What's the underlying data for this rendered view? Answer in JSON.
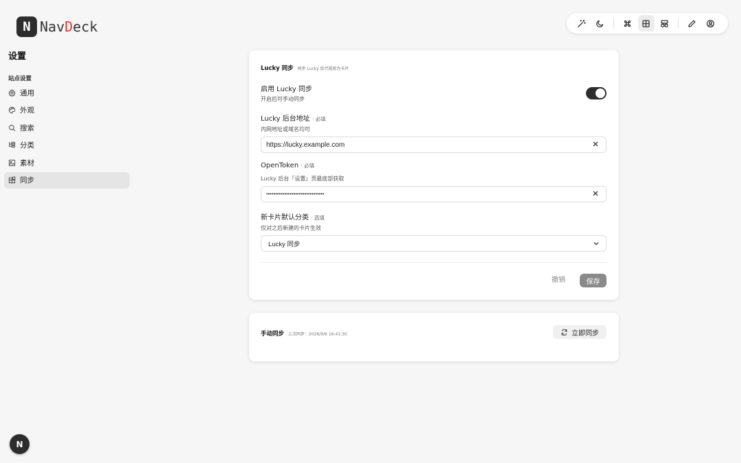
{
  "app": {
    "logo_letter": "N",
    "name_prefix": "Nav",
    "name_accent": "D",
    "name_suffix": "eck"
  },
  "toolbar": {
    "icons": [
      "magic-wand-icon",
      "moon-icon",
      "command-icon",
      "grid-icon",
      "layout-icon",
      "pencil-icon",
      "user-circle-icon"
    ],
    "active": "grid-icon"
  },
  "sidebar": {
    "title": "设置",
    "section": "站点设置",
    "items": [
      {
        "label": "通用",
        "icon": "gear-icon"
      },
      {
        "label": "外观",
        "icon": "palette-icon"
      },
      {
        "label": "搜索",
        "icon": "search-icon"
      },
      {
        "label": "分类",
        "icon": "tree-icon"
      },
      {
        "label": "素材",
        "icon": "image-icon"
      },
      {
        "label": "同步",
        "icon": "blocks-icon",
        "active": true
      }
    ]
  },
  "lucky_card": {
    "title": "Lucky 同步",
    "subtitle": "同步 Lucky 反代规则为卡片",
    "enable": {
      "label": "启用 Lucky 同步",
      "desc": "开启后可手动同步",
      "on": true
    },
    "address": {
      "label": "Lucky 后台地址",
      "hint": "· 必填",
      "desc": "内网地址或域名均可",
      "value": "https://lucky.example.com"
    },
    "token": {
      "label": "OpenToken",
      "hint": "· 必填",
      "desc": "Lucky 后台「设置」页最底部获取",
      "value": "••••••••••••••••••••••••••••••••"
    },
    "category": {
      "label": "新卡片默认分类",
      "hint": "· 选填",
      "desc": "仅对之后新建的卡片生效",
      "value": "Lucky 同步"
    },
    "cancel_label": "撤销",
    "save_label": "保存"
  },
  "sync_card": {
    "title": "手动同步",
    "last_sync": "上次同步：2026/9/6 16:41:30",
    "button_label": "立即同步"
  },
  "floating": {
    "letter": "N"
  },
  "colors": {
    "accent": "#e03a3a",
    "dark": "#2d2d2d"
  }
}
